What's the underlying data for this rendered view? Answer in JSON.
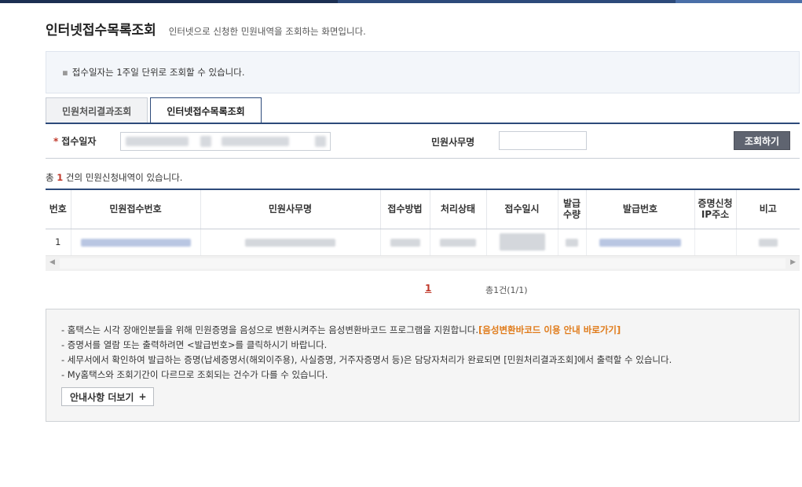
{
  "header": {
    "title": "인터넷접수목록조회",
    "description": "인터넷으로 신청한 민원내역을 조회하는 화면입니다."
  },
  "notice": {
    "text": "접수일자는 1주일 단위로 조회할 수 있습니다."
  },
  "tabs": [
    {
      "label": "민원처리결과조회",
      "active": false
    },
    {
      "label": "인터넷접수목록조회",
      "active": true
    }
  ],
  "search": {
    "date_label": "접수일자",
    "required_mark": "*",
    "office_label": "민원사무명",
    "office_value": "",
    "button_label": "조회하기"
  },
  "result": {
    "prefix": "총",
    "count": "1",
    "suffix": "건의 민원신청내역이 있습니다."
  },
  "table": {
    "columns": [
      "번호",
      "민원접수번호",
      "민원사무명",
      "접수방법",
      "처리상태",
      "접수일시",
      "발급\n수량",
      "발급번호",
      "증명신청\nIP주소",
      "비고"
    ],
    "rows": [
      {
        "no": "1"
      }
    ]
  },
  "pagination": {
    "current": "1",
    "total_text": "총1건(1/1)"
  },
  "info": {
    "lines": [
      "- 홈택스는 시각 장애인분들을 위해 민원증명을 음성으로 변환시켜주는 음성변환바코드 프로그램을 지원합니다.",
      "- 증명서를 열람 또는 출력하려면 <발급번호>를 클릭하시기 바랍니다.",
      "- 세무서에서 확인하여 발급하는 증명(납세증명서(해외이주용), 사실증명, 거주자증명서 등)은 담당자처리가 완료되면 [민원처리결과조회]에서 출력할 수 있습니다.",
      "- My홈택스와 조회기간이 다르므로 조회되는 건수가 다를 수 있습니다."
    ],
    "link_text": "[음성변환바코드 이용 안내 바로가기]",
    "more_label": "안내사항 더보기"
  },
  "colors": {
    "primary": "#2d4a7a",
    "accent": "#c0392b",
    "link_orange": "#e07b1a"
  }
}
